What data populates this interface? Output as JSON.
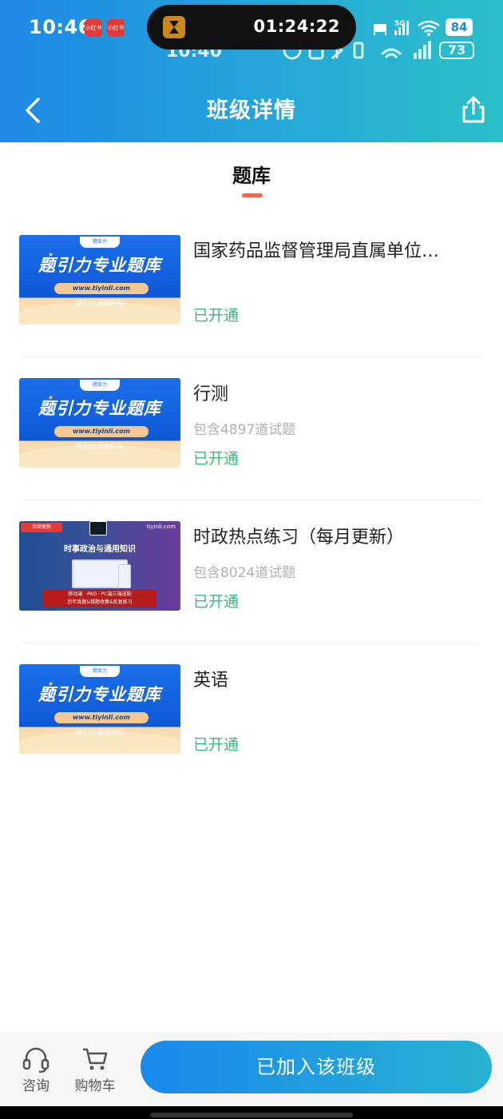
{
  "status_bar": {
    "time": "10:46",
    "app_badge": "小红书",
    "island_timer": "01:24:22",
    "battery": "84",
    "ghost_time": "10:40",
    "ghost_battery": "73"
  },
  "nav": {
    "title": "班级详情",
    "back_icon": "chevron-left-icon",
    "share_icon": "share-icon"
  },
  "tab": {
    "label": "题库",
    "indicator_color": "#f06a4a"
  },
  "items": [
    {
      "title": "国家药品监督管理局直属单位…",
      "count": "",
      "status": "已开通",
      "thumb": {
        "banner": "题引力专业题库",
        "url": "www.tiyinli.com",
        "copyright": "题引力 版权所有",
        "cap": "题库力"
      }
    },
    {
      "title": "行测",
      "count": "包含4897道试题",
      "status": "已开通",
      "thumb": {
        "banner": "题引力专业题库",
        "url": "www.tiyinli.com",
        "copyright": "题引力 版权所有",
        "cap": "题库力"
      }
    },
    {
      "title": "时政热点练习（每月更新）",
      "count": "包含8024道试题",
      "status": "已开通",
      "thumb": {
        "tag": "持续更新",
        "site": "tiyinli.com",
        "headline": "时事政治与通用知识",
        "bar_line1": "移动端 · PAD · PC端三端适配",
        "bar_line2": "历年真题&错题收集&反复练习"
      }
    },
    {
      "title": "英语",
      "count": "",
      "status": "已开通",
      "thumb": {
        "banner": "题引力专业题库",
        "url": "www.tiyinli.com",
        "copyright": "题引力 版权所有",
        "cap": "题库力"
      }
    }
  ],
  "bottom_bar": {
    "consult_label": "咨询",
    "consult_icon": "headset-icon",
    "cart_label": "购物车",
    "cart_icon": "cart-icon",
    "join_label": "已加入该班级"
  },
  "colors": {
    "status_green": "#3bb77e",
    "header_start": "#1e88e5",
    "header_end": "#2bc0c9"
  }
}
